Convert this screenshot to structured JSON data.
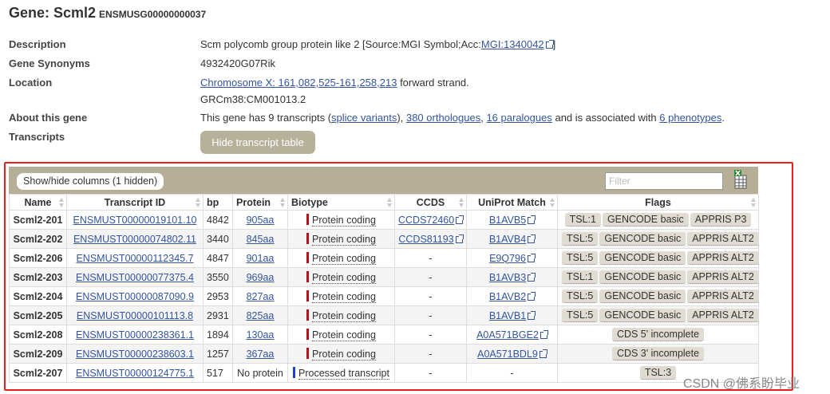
{
  "gene": {
    "title": "Gene: Scml2",
    "stable_id": "ENSMUSG00000000037"
  },
  "summary": [
    {
      "label": "Description",
      "lines": [
        {
          "text": "Scm polycomb group protein like 2 [Source:MGI Symbol;Acc:",
          "link": "MGI:1340042",
          "after": "]"
        }
      ]
    },
    {
      "label": "Gene Synonyms",
      "lines": [
        {
          "text": "4932420G07Rik"
        }
      ]
    },
    {
      "label": "Location",
      "lines": [
        {
          "link": "Chromosome X: 161,082,525-161,258,213",
          "after": " forward strand."
        },
        {
          "text": "GRCm38:CM001013.2"
        }
      ]
    }
  ],
  "about": {
    "label": "About this gene",
    "t1": "This gene has 9 transcripts (",
    "l1": "splice variants",
    "t2": "), ",
    "l2": "380 orthologues",
    "t3": ", ",
    "l3": "16 paralogues",
    "t4": " and is associated with ",
    "l4": "6 phenotypes",
    "t5": "."
  },
  "transcripts_label": "Transcripts",
  "hide_button": "Hide transcript table",
  "table": {
    "show_hide": "Show/hide columns (1 hidden)",
    "filter_placeholder": "Filter",
    "columns": [
      "Name",
      "Transcript ID",
      "bp",
      "Protein",
      "Biotype",
      "CCDS",
      "UniProt Match",
      "Flags"
    ],
    "biotype_colors": {
      "Protein coding": "#b5121b",
      "Processed transcript": "#1f3fd6"
    },
    "rows": [
      {
        "name": "Scml2-201",
        "id": "ENSMUST00000019101.10",
        "bp": "4842",
        "protein": "905aa",
        "biotype": "Protein coding",
        "ccds": "CCDS72460",
        "uniprot": "B1AVB5",
        "flags": [
          "TSL:1",
          "GENCODE basic",
          "APPRIS P3"
        ]
      },
      {
        "name": "Scml2-202",
        "id": "ENSMUST00000074802.11",
        "bp": "3440",
        "protein": "845aa",
        "biotype": "Protein coding",
        "ccds": "CCDS81193",
        "uniprot": "B1AVB4",
        "flags": [
          "TSL:5",
          "GENCODE basic",
          "APPRIS ALT2"
        ]
      },
      {
        "name": "Scml2-206",
        "id": "ENSMUST00000112345.7",
        "bp": "4847",
        "protein": "901aa",
        "biotype": "Protein coding",
        "ccds": "-",
        "uniprot": "E9Q796",
        "flags": [
          "TSL:5",
          "GENCODE basic",
          "APPRIS ALT2"
        ]
      },
      {
        "name": "Scml2-203",
        "id": "ENSMUST00000077375.4",
        "bp": "3550",
        "protein": "969aa",
        "biotype": "Protein coding",
        "ccds": "-",
        "uniprot": "B1AVB3",
        "flags": [
          "TSL:1",
          "GENCODE basic",
          "APPRIS ALT2"
        ]
      },
      {
        "name": "Scml2-204",
        "id": "ENSMUST00000087090.9",
        "bp": "2953",
        "protein": "827aa",
        "biotype": "Protein coding",
        "ccds": "-",
        "uniprot": "B1AVB2",
        "flags": [
          "TSL:5",
          "GENCODE basic",
          "APPRIS ALT2"
        ]
      },
      {
        "name": "Scml2-205",
        "id": "ENSMUST00000101113.8",
        "bp": "2931",
        "protein": "825aa",
        "biotype": "Protein coding",
        "ccds": "-",
        "uniprot": "B1AVB1",
        "flags": [
          "TSL:5",
          "GENCODE basic",
          "APPRIS ALT2"
        ]
      },
      {
        "name": "Scml2-208",
        "id": "ENSMUST00000238361.1",
        "bp": "1894",
        "protein": "130aa",
        "biotype": "Protein coding",
        "ccds": "-",
        "uniprot": "A0A571BGE2",
        "flags": [
          "CDS 5' incomplete"
        ]
      },
      {
        "name": "Scml2-209",
        "id": "ENSMUST00000238603.1",
        "bp": "1257",
        "protein": "367aa",
        "biotype": "Protein coding",
        "ccds": "-",
        "uniprot": "A0A571BDL9",
        "flags": [
          "CDS 3' incomplete"
        ]
      },
      {
        "name": "Scml2-207",
        "id": "ENSMUST00000124775.1",
        "bp": "517",
        "protein": "No protein",
        "biotype": "Processed transcript",
        "ccds": "-",
        "uniprot": "-",
        "flags": [
          "TSL:3"
        ]
      }
    ]
  },
  "watermark": "CSDN @佛系盼毕业"
}
